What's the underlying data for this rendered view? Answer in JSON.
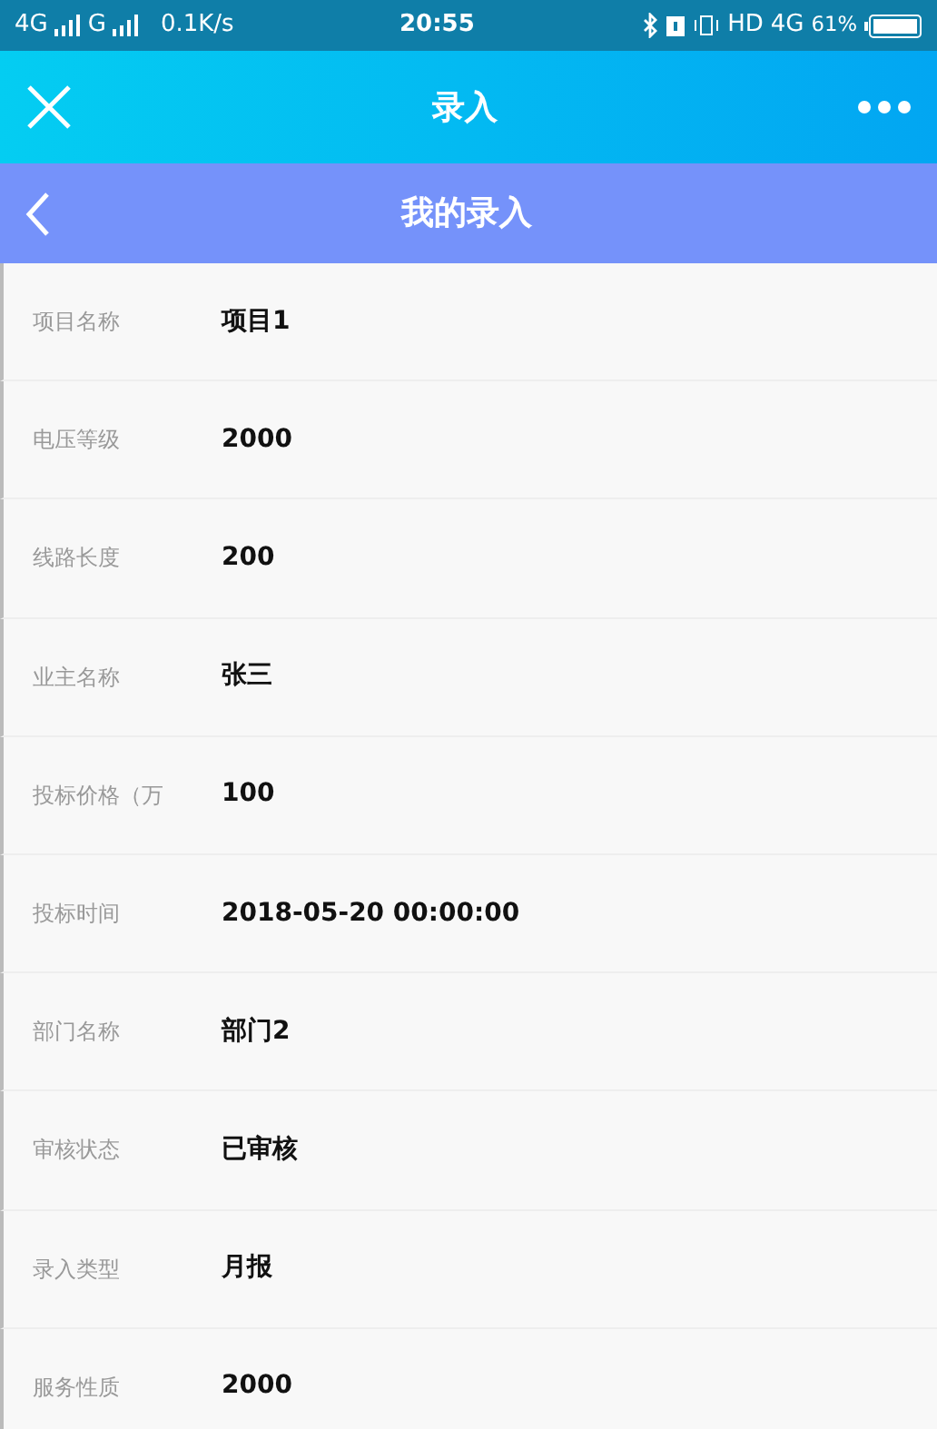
{
  "status_bar": {
    "left": [
      "4G",
      "G"
    ],
    "speed": "0.1K/s",
    "time": "20:55",
    "right": [
      "HD",
      "4G"
    ],
    "battery": "61%"
  },
  "top_bar": {
    "title": "录入"
  },
  "header": {
    "title": "我的录入"
  },
  "fields": [
    {
      "label": "项目名称",
      "value": "项目1"
    },
    {
      "label": "电压等级",
      "value": "2000"
    },
    {
      "label": "线路长度",
      "value": "200"
    },
    {
      "label": "业主名称",
      "value": "张三"
    },
    {
      "label": "投标价格（万",
      "value": "100"
    },
    {
      "label": "投标时间",
      "value": "2018-05-20 00:00:00"
    },
    {
      "label": "部门名称",
      "value": "部门2"
    },
    {
      "label": "审核状态",
      "value": "已审核"
    },
    {
      "label": "录入类型",
      "value": "月报"
    },
    {
      "label": "服务性质",
      "value": "2000"
    }
  ]
}
